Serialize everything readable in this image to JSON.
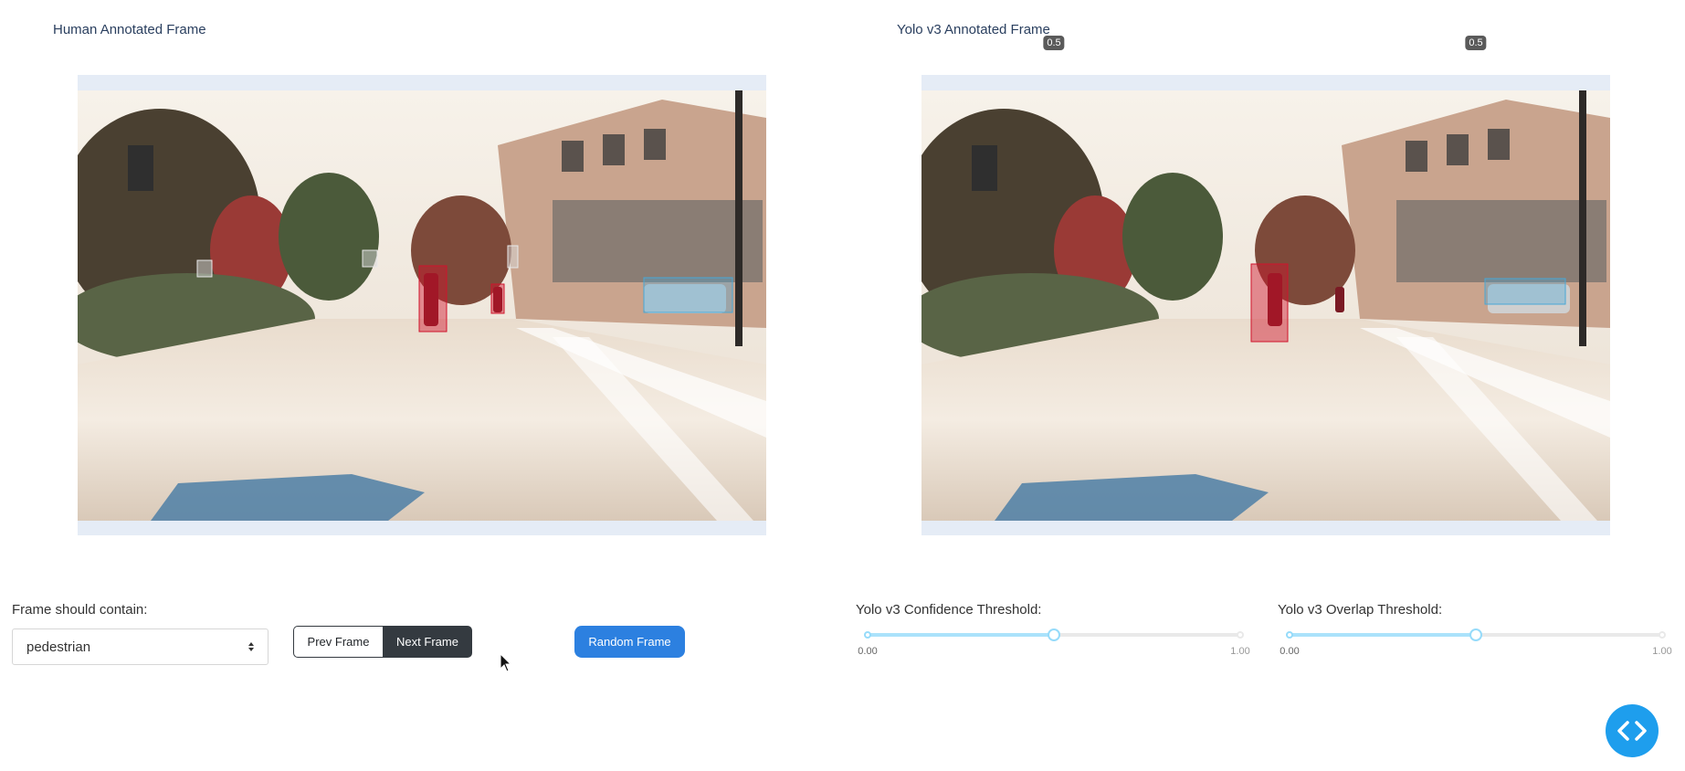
{
  "panels": {
    "left_title": "Human Annotated Frame",
    "right_title": "Yolo v3 Annotated Frame"
  },
  "scene": {
    "description_icons": [
      "tree-icon",
      "building-icon",
      "car-icon",
      "pedestrian-icon"
    ],
    "human_boxes": [
      "pedestrian",
      "pedestrian",
      "car",
      "traffic light",
      "traffic light",
      "traffic light"
    ],
    "yolo_boxes": [
      "pedestrian",
      "car"
    ]
  },
  "controls": {
    "frame_label": "Frame should contain:",
    "frame_value": "pedestrian",
    "prev_label": "Prev Frame",
    "next_label": "Next Frame",
    "random_label": "Random Frame"
  },
  "sliders": {
    "confidence": {
      "label": "Yolo v3 Confidence Threshold:",
      "min_label": "0.00",
      "max_label": "1.00",
      "value": 0.5,
      "value_label": "0.5"
    },
    "overlap": {
      "label": "Yolo v3 Overlap Threshold:",
      "min_label": "0.00",
      "max_label": "1.00",
      "value": 0.5,
      "value_label": "0.5"
    }
  },
  "colors": {
    "pedestrian_box": "#d0142c",
    "car_box": "#48a7d6",
    "traffic_light_box": "#d8d8d8",
    "accent": "#2c80e0",
    "slider_track": "#abe2fb"
  }
}
